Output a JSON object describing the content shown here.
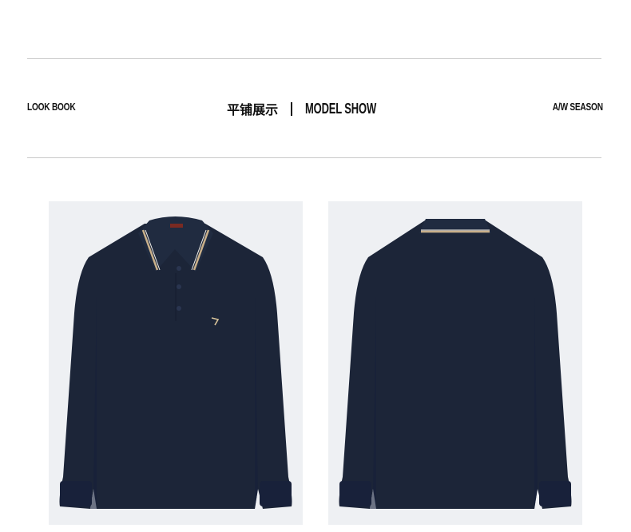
{
  "header": {
    "left_label": "LOOK BOOK",
    "center_cn": "平铺展示",
    "center_en": "MODEL SHOW",
    "right_label": "A/W SEASON"
  },
  "products": [
    {
      "view": "front",
      "color": "#1c2538",
      "collar_trim": "#c9b08a"
    },
    {
      "view": "back",
      "color": "#1c2538",
      "collar_trim": "#c9b08a"
    }
  ]
}
